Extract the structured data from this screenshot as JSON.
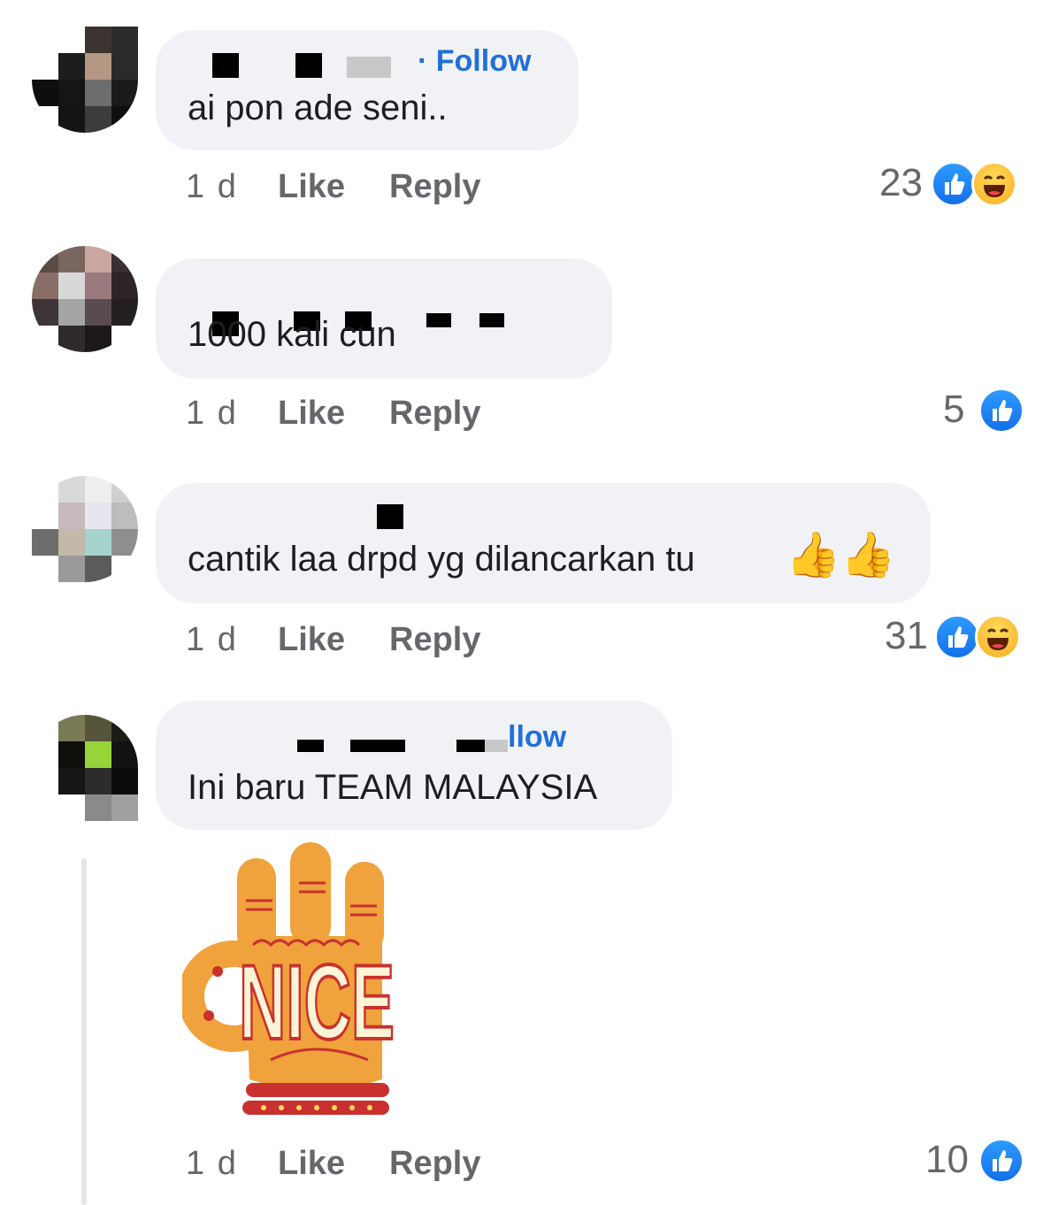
{
  "comments": [
    {
      "follow_label": "· Follow",
      "text": "ai pon ade seni..",
      "time": "1 d",
      "like_label": "Like",
      "reply_label": "Reply",
      "reaction_count": "23",
      "reactions": [
        "like-icon",
        "haha-icon"
      ]
    },
    {
      "text": "1000 kali cun",
      "time": "1 d",
      "like_label": "Like",
      "reply_label": "Reply",
      "reaction_count": "5",
      "reactions": [
        "like-icon"
      ]
    },
    {
      "text": "cantik laa drpd yg dilancarkan tu",
      "emoji": "👍👍",
      "time": "1 d",
      "like_label": "Like",
      "reply_label": "Reply",
      "reaction_count": "31",
      "reactions": [
        "like-icon",
        "haha-icon"
      ]
    },
    {
      "follow_label": "llow",
      "text": "Ini baru TEAM MALAYSIA",
      "sticker_text": "NICE",
      "time": "1 d",
      "like_label": "Like",
      "reply_label": "Reply",
      "reaction_count": "10",
      "reactions": [
        "like-icon"
      ]
    }
  ],
  "colors": {
    "bubble": "#f0f2f5",
    "link_blue": "#216fdb",
    "meta_gray": "#65676b",
    "like_blue": "#1877f2",
    "sticker_orange": "#f0a23c",
    "sticker_red": "#c8312f"
  }
}
